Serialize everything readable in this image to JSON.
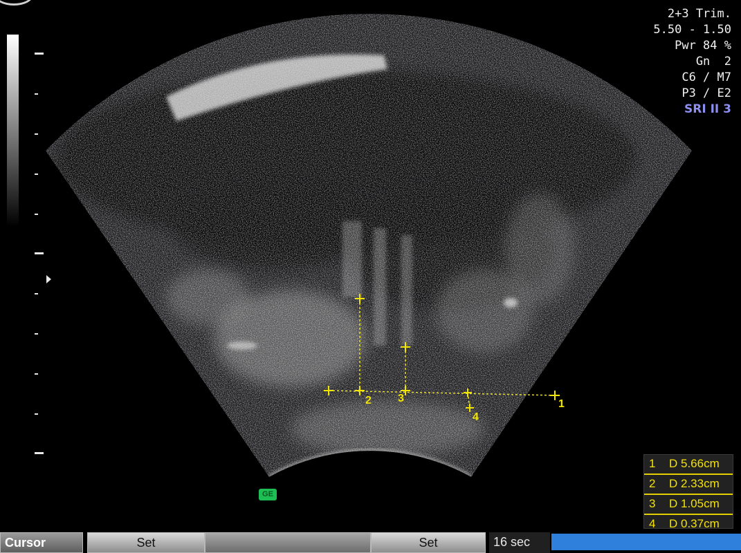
{
  "settings": {
    "lines": [
      "2+3 Trim.",
      "5.50 - 1.50",
      "Pwr 84 %",
      "Gn  2",
      "C6 / M7",
      "P3 / E2"
    ],
    "sri": "SRI II 3"
  },
  "measurements": [
    {
      "index": "1",
      "value": "D 5.66cm"
    },
    {
      "index": "2",
      "value": "D 2.33cm"
    },
    {
      "index": "3",
      "value": "D 1.05cm"
    },
    {
      "index": "4",
      "value": "D 0.37cm"
    }
  ],
  "caliper_labels": [
    "1",
    "2",
    "3",
    "4"
  ],
  "badge": "GE",
  "softkeys": {
    "cursor": "Cursor",
    "set_left": "Set",
    "set_right": "Set",
    "timer": "16 sec"
  },
  "colors": {
    "caliper": "#f2e600",
    "sri": "#8c8ff0",
    "timer_bar": "#2f7fdc",
    "badge": "#1dbf55"
  }
}
